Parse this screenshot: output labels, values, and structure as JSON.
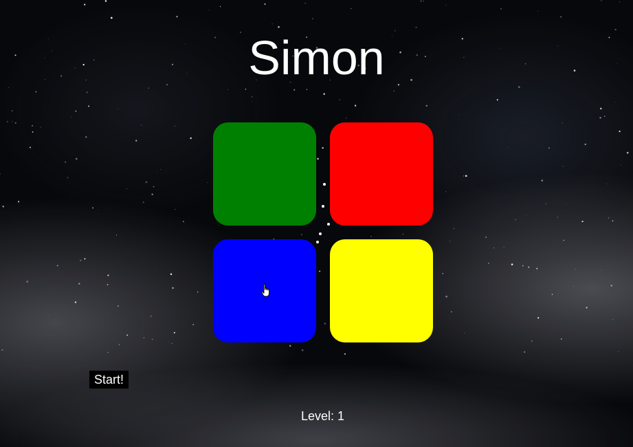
{
  "game": {
    "title": "Simon",
    "pads": [
      {
        "id": "green",
        "color": "#008000"
      },
      {
        "id": "red",
        "color": "#ff0000"
      },
      {
        "id": "blue",
        "color": "#0000ff"
      },
      {
        "id": "yellow",
        "color": "#ffff00"
      }
    ],
    "start_label": "Start!",
    "level_label": "Level: 1"
  },
  "background": {
    "theme": "night sky with stars and clouds",
    "base_color": "#07080b"
  }
}
